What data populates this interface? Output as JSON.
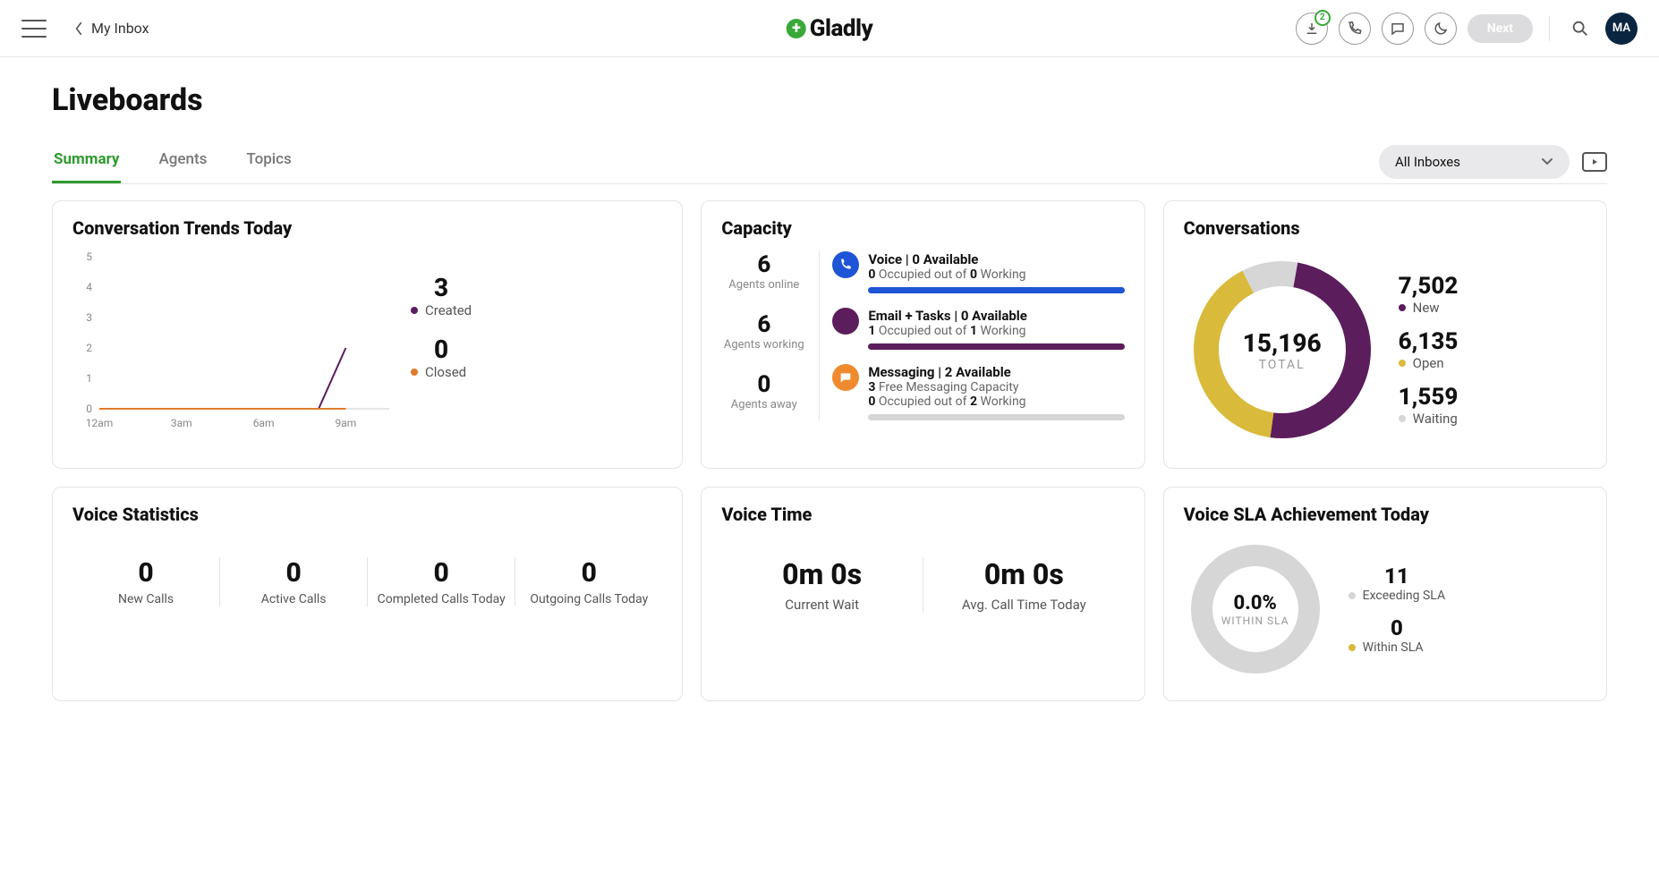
{
  "header": {
    "back_label": "My Inbox",
    "logo_text": "Gladly",
    "download_badge": "2",
    "next_label": "Next",
    "avatar": "MA"
  },
  "page_title": "Liveboards",
  "tabs": [
    "Summary",
    "Agents",
    "Topics"
  ],
  "active_tab_index": 0,
  "filter": {
    "selected": "All Inboxes"
  },
  "trends": {
    "title": "Conversation Trends Today",
    "y_ticks": [
      "5",
      "4",
      "3",
      "2",
      "1",
      "0"
    ],
    "x_ticks": [
      "12am",
      "3am",
      "6am",
      "9am"
    ],
    "legend": {
      "created": {
        "value": "3",
        "label": "Created",
        "color": "#5c1d5c"
      },
      "closed": {
        "value": "0",
        "label": "Closed",
        "color": "#e07b2e"
      }
    }
  },
  "capacity": {
    "title": "Capacity",
    "left": [
      {
        "value": "6",
        "label": "Agents online"
      },
      {
        "value": "6",
        "label": "Agents working"
      },
      {
        "value": "0",
        "label": "Agents away"
      }
    ],
    "rows": {
      "voice": {
        "title": "Voice | 0 Available",
        "sub_parts": [
          "0",
          " Occupied out of ",
          "0",
          " Working"
        ],
        "color": "#1e55d6"
      },
      "email": {
        "title": "Email + Tasks | 0 Available",
        "sub_parts": [
          "1",
          " Occupied out of ",
          "1",
          " Working"
        ],
        "color": "#5c1d5c"
      },
      "msg": {
        "title": "Messaging | 2 Available",
        "line1_parts": [
          "3",
          " Free Messaging Capacity"
        ],
        "sub_parts": [
          "0",
          " Occupied out of ",
          "2",
          " Working"
        ],
        "icon_color": "#f08a2e",
        "bar_color": "#d6d6d6"
      }
    }
  },
  "conversations": {
    "title": "Conversations",
    "total": {
      "value": "15,196",
      "label": "TOTAL"
    },
    "segments": [
      {
        "value": "7,502",
        "label": "New",
        "color": "#5c1d5c",
        "pct": 49.4
      },
      {
        "value": "6,135",
        "label": "Open",
        "color": "#d9ba3b",
        "pct": 40.4
      },
      {
        "value": "1,559",
        "label": "Waiting",
        "color": "#d6d6d6",
        "pct": 10.2
      }
    ]
  },
  "voice_stats": {
    "title": "Voice Statistics",
    "items": [
      {
        "value": "0",
        "label": "New Calls"
      },
      {
        "value": "0",
        "label": "Active Calls"
      },
      {
        "value": "0",
        "label": "Completed Calls Today"
      },
      {
        "value": "0",
        "label": "Outgoing Calls Today"
      }
    ]
  },
  "voice_time": {
    "title": "Voice Time",
    "items": [
      {
        "value": "0m 0s",
        "label": "Current Wait"
      },
      {
        "value": "0m 0s",
        "label": "Avg. Call Time Today"
      }
    ]
  },
  "sla": {
    "title": "Voice SLA Achievement Today",
    "center": {
      "value": "0.0%",
      "label": "WITHIN SLA"
    },
    "legend": [
      {
        "value": "11",
        "label": "Exceeding SLA",
        "color": "#d6d6d6"
      },
      {
        "value": "0",
        "label": "Within SLA",
        "color": "#d9ba3b"
      }
    ]
  },
  "chart_data": {
    "type": "line",
    "title": "Conversation Trends Today",
    "xlabel": "",
    "ylabel": "",
    "x_ticks": [
      "12am",
      "3am",
      "6am",
      "9am"
    ],
    "ylim": [
      0,
      5
    ],
    "series": [
      {
        "name": "Created",
        "color": "#5c1d5c",
        "x": [
          "12am",
          "3am",
          "6am",
          "8am",
          "9am"
        ],
        "values": [
          0,
          0,
          0,
          0,
          2
        ]
      },
      {
        "name": "Closed",
        "color": "#e07b2e",
        "x": [
          "12am",
          "3am",
          "6am",
          "9am"
        ],
        "values": [
          0,
          0,
          0,
          0
        ]
      }
    ]
  }
}
